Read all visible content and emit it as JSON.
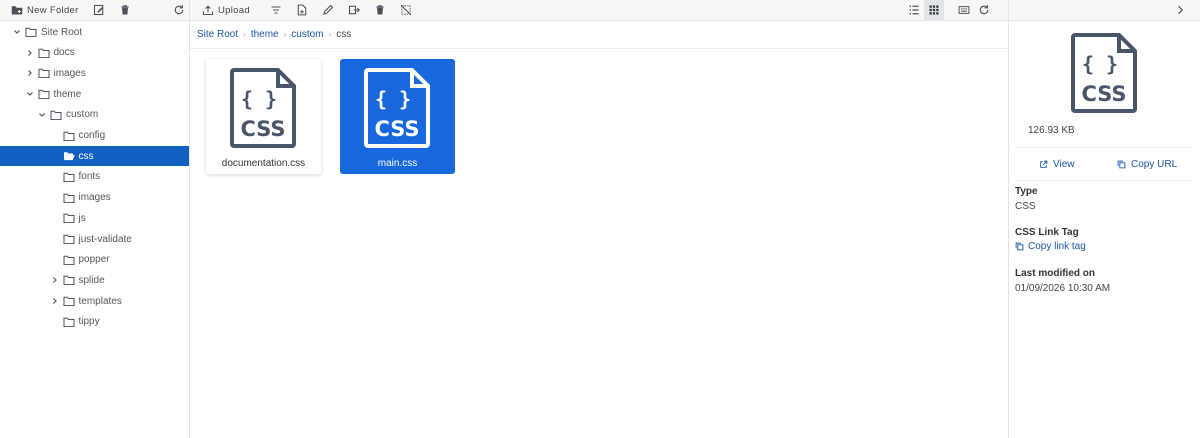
{
  "colors": {
    "accent": "#1668dc",
    "tree_selected": "#1160c2",
    "link": "#1a56a8",
    "icon": "#49556a"
  },
  "left_toolbar": {
    "new_folder_label": "New Folder",
    "icons": [
      "new-folder-icon",
      "rename-icon",
      "trash-icon",
      "refresh-icon"
    ]
  },
  "tree": {
    "items": [
      {
        "label": "Site Root",
        "depth": 0,
        "expander": "expanded",
        "open": false
      },
      {
        "label": "docs",
        "depth": 1,
        "expander": "collapsed",
        "open": false
      },
      {
        "label": "images",
        "depth": 1,
        "expander": "collapsed",
        "open": false
      },
      {
        "label": "theme",
        "depth": 1,
        "expander": "expanded",
        "open": false
      },
      {
        "label": "custom",
        "depth": 2,
        "expander": "expanded",
        "open": false
      },
      {
        "label": "config",
        "depth": 3,
        "expander": "none",
        "open": false
      },
      {
        "label": "css",
        "depth": 3,
        "expander": "none",
        "open": true,
        "selected": true
      },
      {
        "label": "fonts",
        "depth": 3,
        "expander": "none",
        "open": false
      },
      {
        "label": "images",
        "depth": 3,
        "expander": "none",
        "open": false
      },
      {
        "label": "js",
        "depth": 3,
        "expander": "none",
        "open": false
      },
      {
        "label": "just-validate",
        "depth": 3,
        "expander": "none",
        "open": false
      },
      {
        "label": "popper",
        "depth": 3,
        "expander": "none",
        "open": false
      },
      {
        "label": "splide",
        "depth": 3,
        "expander": "collapsed",
        "open": false
      },
      {
        "label": "templates",
        "depth": 3,
        "expander": "collapsed",
        "open": false
      },
      {
        "label": "tippy",
        "depth": 3,
        "expander": "none",
        "open": false
      }
    ]
  },
  "main_toolbar": {
    "upload_label": "Upload",
    "icons": [
      "upload-icon",
      "sort-icon",
      "new-file-icon",
      "edit-icon",
      "move-icon",
      "trash-icon",
      "deselect-icon",
      "list-view-icon",
      "grid-view-icon",
      "thumbnail-view-icon",
      "refresh-icon"
    ],
    "view_mode": "grid"
  },
  "breadcrumb": [
    "Site Root",
    "theme",
    "custom",
    "css"
  ],
  "files": [
    {
      "name": "documentation.css",
      "icon_text": "CSS",
      "icon_braces": "{ }",
      "selected": false
    },
    {
      "name": "main.css",
      "icon_text": "CSS",
      "icon_braces": "{ }",
      "selected": true
    }
  ],
  "details": {
    "icon_text": "CSS",
    "icon_braces": "{ }",
    "size": "126.93 KB",
    "view_label": "View",
    "copy_url_label": "Copy URL",
    "type_label": "Type",
    "type_value": "CSS",
    "css_link_tag_label": "CSS Link Tag",
    "copy_link_tag_label": "Copy link tag",
    "last_modified_label": "Last modified on",
    "last_modified_value": "01/09/2026 10:30 AM"
  }
}
